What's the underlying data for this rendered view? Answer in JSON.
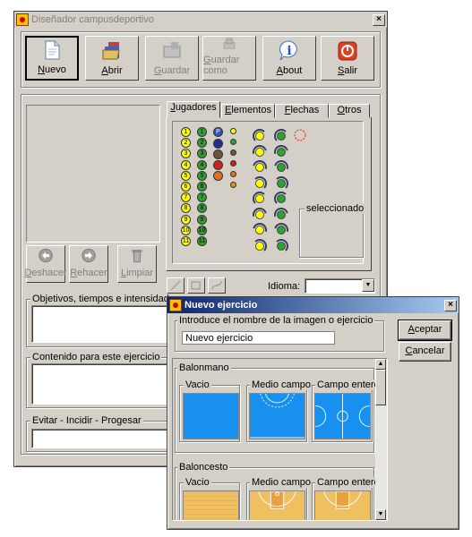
{
  "main_window": {
    "title": "Diseñador campusdeportivo",
    "close": "×",
    "toolbar": [
      {
        "id": "nuevo",
        "label": "Nuevo",
        "hot": "N",
        "rest": "uevo",
        "icon": "new-file-icon",
        "enabled": true
      },
      {
        "id": "abrir",
        "label": "Abrir",
        "hot": "A",
        "rest": "brir",
        "icon": "open-folder-icon",
        "enabled": true
      },
      {
        "id": "guardar",
        "label": "Guardar",
        "hot": "G",
        "rest": "uardar",
        "icon": "save-icon",
        "enabled": false
      },
      {
        "id": "guardar_como",
        "label": "Guardar como",
        "hot": "G",
        "rest": "uardar como",
        "icon": "save-as-icon",
        "enabled": false
      },
      {
        "id": "about",
        "label": "About",
        "hot": "A",
        "rest": "bout",
        "icon": "info-icon",
        "enabled": true
      },
      {
        "id": "salir",
        "label": "Salir",
        "hot": "S",
        "rest": "alir",
        "icon": "power-icon",
        "enabled": true
      }
    ],
    "edit_buttons": [
      {
        "label": "Deshacer",
        "hot": "D",
        "rest": "eshacer",
        "icon": "undo-icon"
      },
      {
        "label": "Rehacer",
        "hot": "R",
        "rest": "ehacer",
        "icon": "redo-icon"
      },
      {
        "label": "Limpiar",
        "hot": "L",
        "rest": "impiar",
        "icon": "clear-icon"
      }
    ],
    "tabs": [
      {
        "label": "Jugadores",
        "hot": "J",
        "rest": "ugadores",
        "active": true
      },
      {
        "label": "Elementos",
        "hot": "E",
        "rest": "lementos",
        "active": false
      },
      {
        "label": "Flechas",
        "hot": "F",
        "rest": "lechas",
        "active": false
      },
      {
        "label": "Otros",
        "hot": "O",
        "rest": "tros",
        "active": false
      }
    ],
    "yellow_numbers": [
      "1",
      "2",
      "3",
      "4",
      "5",
      "6",
      "7",
      "8",
      "9",
      "10",
      "11"
    ],
    "green_numbers": [
      "1",
      "2",
      "3",
      "4",
      "5",
      "6",
      "7",
      "8",
      "9",
      "10",
      "11"
    ],
    "special_ball": "P",
    "selected_label": "seleccionado",
    "idioma_label": "Idioma:",
    "idioma_value": "",
    "groups": {
      "objetivos": "Objetivos, tiempos e intensidades",
      "contenido": "Contenido para este ejercicio",
      "evitar": "Evitar - Incidir - Progesar"
    }
  },
  "dialog": {
    "title": "Nuevo ejercicio",
    "close": "×",
    "name_label": "Introduce el nombre de la imagen o ejercicio",
    "name_value": "Nuevo ejercicio",
    "accept": "Aceptar",
    "accept_hot": "A",
    "accept_rest": "ceptar",
    "cancel": "Cancelar",
    "cancel_hot": "C",
    "cancel_rest": "ancelar",
    "sports": [
      {
        "name": "Balonmano",
        "options": [
          "Vacio",
          "Medio campo",
          "Campo entero"
        ]
      },
      {
        "name": "Baloncesto",
        "options": [
          "Vacio",
          "Medio campo",
          "Campo entero"
        ]
      }
    ]
  }
}
